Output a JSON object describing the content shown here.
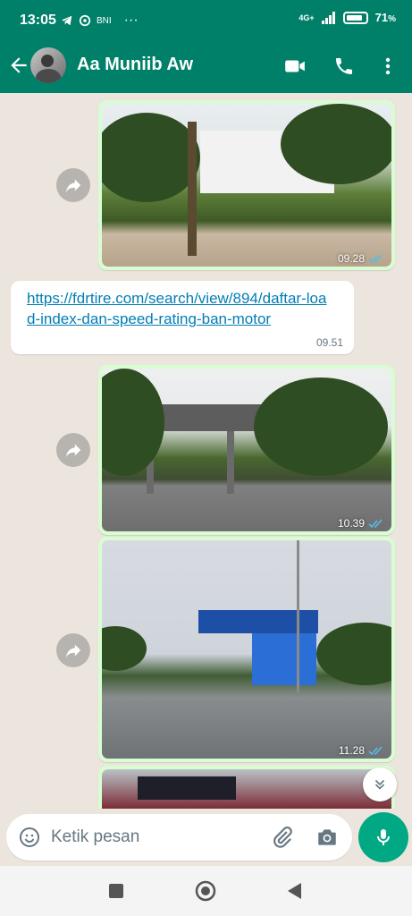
{
  "status_bar": {
    "time": "13:05",
    "bank_label": "BNI",
    "network": "4G+",
    "battery": "71",
    "battery_unit": "%"
  },
  "header": {
    "contact_name": "Aa Muniib Aw",
    "icons": [
      "back-arrow-icon",
      "video-call-icon",
      "phone-icon",
      "more-vertical-icon"
    ]
  },
  "messages": [
    {
      "type": "image",
      "direction": "outgoing",
      "time": "09.28",
      "status": "read"
    },
    {
      "type": "text",
      "direction": "incoming",
      "text": "https://fdrtire.com/search/view/894/daftar-load-index-dan-speed-rating-ban-motor",
      "time": "09.51"
    },
    {
      "type": "image",
      "direction": "outgoing",
      "time": "10.39",
      "status": "read"
    },
    {
      "type": "image",
      "direction": "outgoing",
      "time": "11.28",
      "status": "read"
    },
    {
      "type": "image",
      "direction": "outgoing",
      "time": "",
      "status": ""
    }
  ],
  "composer": {
    "placeholder": "Ketik pesan"
  },
  "colors": {
    "header": "#008069",
    "outgoing_bubble": "#d9fdd3",
    "incoming_bubble": "#ffffff",
    "chat_background": "#ece5dd",
    "mic_button": "#00a884",
    "read_ticks": "#53bdeb"
  }
}
